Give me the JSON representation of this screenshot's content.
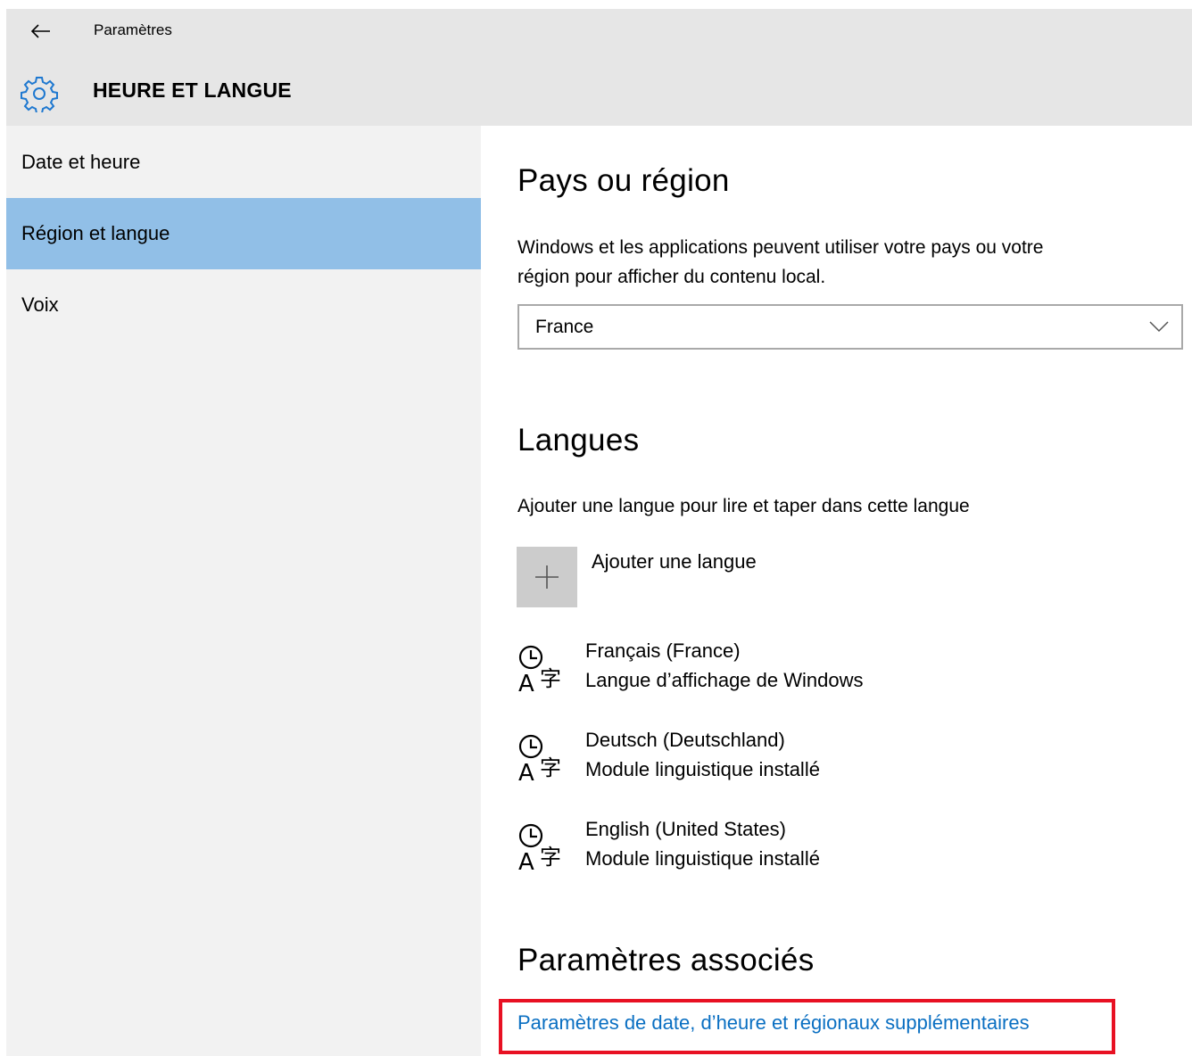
{
  "header": {
    "app_title": "Paramètres",
    "section_title": "HEURE ET LANGUE",
    "accent_color": "#1e78d0"
  },
  "sidebar": {
    "items": [
      {
        "label": "Date et heure",
        "selected": false
      },
      {
        "label": "Région et langue",
        "selected": true
      },
      {
        "label": "Voix",
        "selected": false
      }
    ],
    "selected_color": "#91bfe7"
  },
  "region": {
    "heading": "Pays ou région",
    "description_line1": "Windows et les applications peuvent utiliser votre pays ou votre",
    "description_line2": "région pour afficher du contenu local.",
    "selected_country": "France"
  },
  "languages": {
    "heading": "Langues",
    "description": "Ajouter une langue pour lire et taper dans cette langue",
    "add_label": "Ajouter une langue",
    "items": [
      {
        "name": "Français (France)",
        "status": "Langue d’affichage de Windows"
      },
      {
        "name": "Deutsch (Deutschland)",
        "status": "Module linguistique installé"
      },
      {
        "name": "English (United States)",
        "status": "Module linguistique installé"
      }
    ]
  },
  "related": {
    "heading": "Paramètres associés",
    "link_label": "Paramètres de date, d’heure et régionaux supplémentaires",
    "link_color": "#0a6fc2",
    "highlight_color": "#e81123"
  }
}
